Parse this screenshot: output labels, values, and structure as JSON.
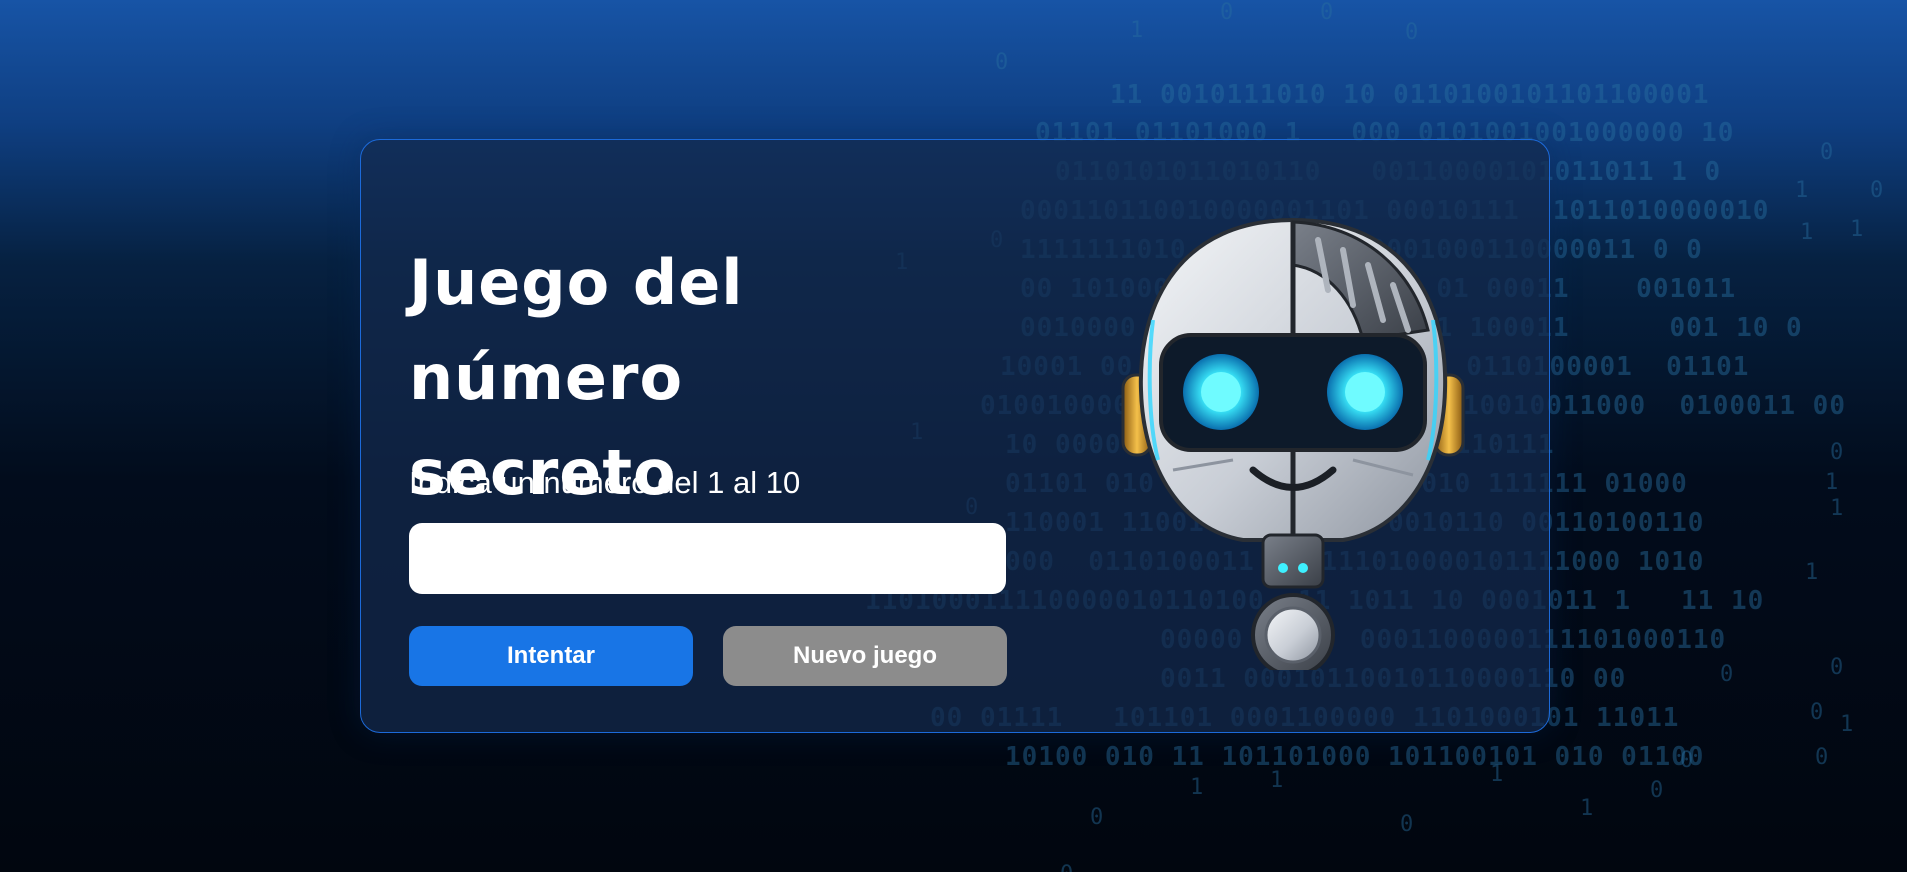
{
  "title": {
    "line1": "Juego del",
    "line2": "número secreto"
  },
  "prompt_label": "Indica un número del 1 al 10",
  "number_input": {
    "value": "",
    "placeholder": ""
  },
  "buttons": {
    "try_label": "Intentar",
    "new_game_label": "Nuevo juego"
  },
  "colors": {
    "accent": "#1875e6",
    "secondary_button": "#8c8c8c",
    "card_border": "#1c6ad9"
  },
  "icons": {
    "mascot": "robot-question-mark-icon"
  }
}
